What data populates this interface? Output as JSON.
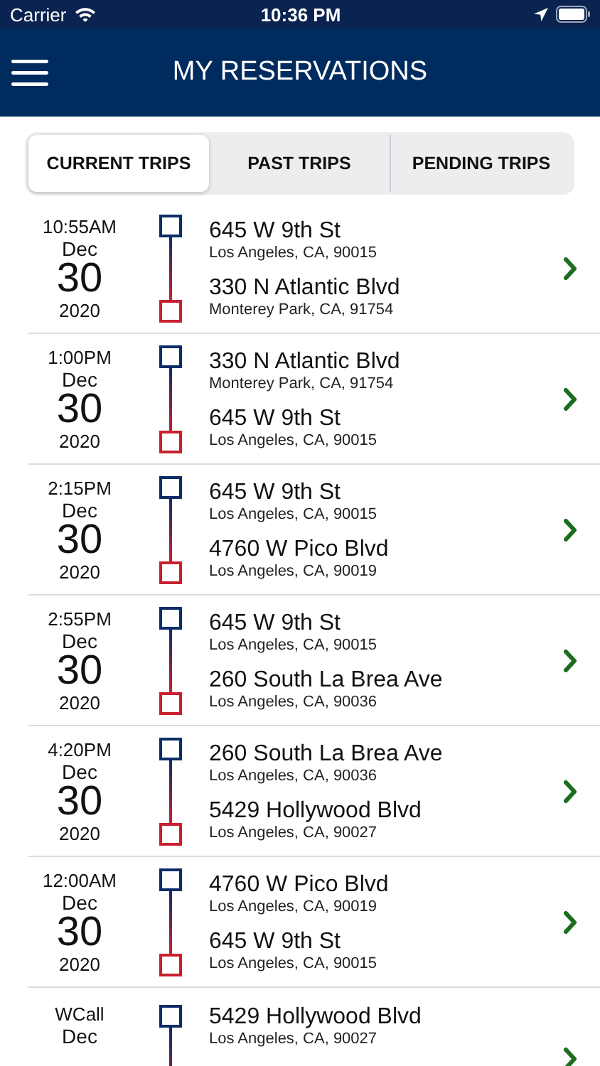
{
  "status_bar": {
    "carrier": "Carrier",
    "time": "10:36 PM"
  },
  "header": {
    "title": "MY RESERVATIONS"
  },
  "tabs": [
    {
      "label": "CURRENT TRIPS",
      "selected": true
    },
    {
      "label": "PAST TRIPS",
      "selected": false
    },
    {
      "label": "PENDING TRIPS",
      "selected": false
    }
  ],
  "trips": [
    {
      "time": "10:55AM",
      "month": "Dec",
      "day": "30",
      "year": "2020",
      "pickup": {
        "street": "645 W 9th St",
        "city": "Los Angeles, CA, 90015"
      },
      "dropoff": {
        "street": "330 N Atlantic Blvd",
        "city": "Monterey Park, CA, 91754"
      }
    },
    {
      "time": "1:00PM",
      "month": "Dec",
      "day": "30",
      "year": "2020",
      "pickup": {
        "street": "330 N Atlantic Blvd",
        "city": "Monterey Park, CA, 91754"
      },
      "dropoff": {
        "street": "645 W 9th St",
        "city": "Los Angeles, CA, 90015"
      }
    },
    {
      "time": "2:15PM",
      "month": "Dec",
      "day": "30",
      "year": "2020",
      "pickup": {
        "street": "645 W 9th St",
        "city": "Los Angeles, CA, 90015"
      },
      "dropoff": {
        "street": "4760 W Pico Blvd",
        "city": "Los Angeles, CA, 90019"
      }
    },
    {
      "time": "2:55PM",
      "month": "Dec",
      "day": "30",
      "year": "2020",
      "pickup": {
        "street": "645 W 9th St",
        "city": "Los Angeles, CA, 90015"
      },
      "dropoff": {
        "street": "260 South La Brea Ave",
        "city": "Los Angeles, CA, 90036"
      }
    },
    {
      "time": "4:20PM",
      "month": "Dec",
      "day": "30",
      "year": "2020",
      "pickup": {
        "street": "260 South La Brea Ave",
        "city": "Los Angeles, CA, 90036"
      },
      "dropoff": {
        "street": "5429 Hollywood Blvd",
        "city": "Los Angeles, CA, 90027"
      }
    },
    {
      "time": "12:00AM",
      "month": "Dec",
      "day": "30",
      "year": "2020",
      "pickup": {
        "street": "4760 W Pico Blvd",
        "city": "Los Angeles, CA, 90019"
      },
      "dropoff": {
        "street": "645 W 9th St",
        "city": "Los Angeles, CA, 90015"
      }
    },
    {
      "time": "WCall",
      "month": "Dec",
      "pickup": {
        "street": "5429 Hollywood Blvd",
        "city": "Los Angeles, CA, 90027"
      }
    }
  ]
}
